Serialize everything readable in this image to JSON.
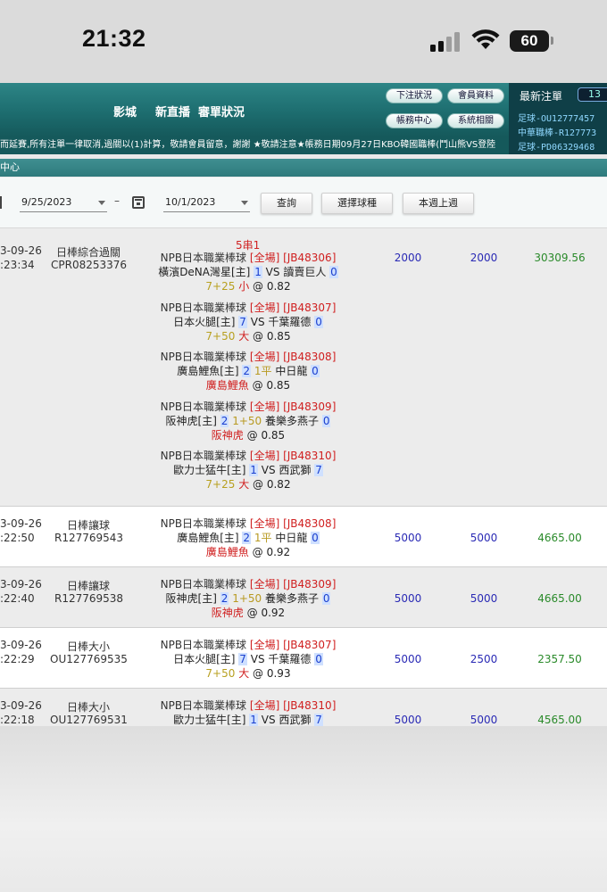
{
  "status_bar": {
    "time": "21:32",
    "battery": "60"
  },
  "nav": {
    "links": [
      "影城",
      "新直播",
      "審單狀況"
    ],
    "buttons": [
      "下注狀況",
      "會員資料",
      "帳務中心",
      "系統相關"
    ],
    "latest_title": "最新注單",
    "latest_count": "13",
    "latest_items": [
      "足球-OU12777457",
      "中華職棒-R127773",
      "足球-PD06329468"
    ]
  },
  "ticker": "而延賽,所有注單一律取消,過關以(1)計算，敬請會員留意，謝謝 ★敬請注意★帳務日期09月27日KBO韓國職棒(鬥山熊VS登陸",
  "section_title": "中心",
  "filter": {
    "start_date": "9/25/2023",
    "end_date": "10/1/2023",
    "dash": "–",
    "buttons": [
      "查詢",
      "選擇球種",
      "本週上週"
    ]
  },
  "rows": [
    {
      "date": "3-09-26",
      "time": ":23:34",
      "type": "日棒綜合過關",
      "id": "CPR08253376",
      "combo": "5串1",
      "stake": "2000",
      "valid": "2000",
      "result": "30309.56",
      "bets": [
        {
          "league": "NPB日本職業棒球",
          "market": "[全場] [JB48306]",
          "home": "橫濱DeNA灣星[主]",
          "hs": "1",
          "mid": "VS",
          "away": "讀賣巨人",
          "as": "0",
          "handicap": "7+25",
          "pick": "小",
          "odds": "@ 0.82"
        },
        {
          "league": "NPB日本職業棒球",
          "market": "[全場] [JB48307]",
          "home": "日本火腿[主]",
          "hs": "7",
          "mid": "VS",
          "away": "千葉羅德",
          "as": "0",
          "handicap": "7+50",
          "pick": "大",
          "odds": "@ 0.85"
        },
        {
          "league": "NPB日本職業棒球",
          "market": "[全場] [JB48308]",
          "home": "廣島鯉魚[主]",
          "hs": "2",
          "mid": "1平",
          "away": "中日龍",
          "as": "0",
          "handicap": "",
          "pick": "廣島鯉魚",
          "odds": "@ 0.85"
        },
        {
          "league": "NPB日本職業棒球",
          "market": "[全場] [JB48309]",
          "home": "阪神虎[主]",
          "hs": "2",
          "mid": "1+50",
          "away": "養樂多燕子",
          "as": "0",
          "handicap": "",
          "pick": "阪神虎",
          "odds": "@ 0.85"
        },
        {
          "league": "NPB日本職業棒球",
          "market": "[全場] [JB48310]",
          "home": "歐力士猛牛[主]",
          "hs": "1",
          "mid": "VS",
          "away": "西武獅",
          "as": "7",
          "handicap": "7+25",
          "pick": "大",
          "odds": "@ 0.82"
        }
      ]
    },
    {
      "date": "3-09-26",
      "time": ":22:50",
      "type": "日棒讓球",
      "id": "R127769543",
      "stake": "5000",
      "valid": "5000",
      "result": "4665.00",
      "bets": [
        {
          "league": "NPB日本職業棒球",
          "market": "[全場] [JB48308]",
          "home": "廣島鯉魚[主]",
          "hs": "2",
          "mid": "1平",
          "away": "中日龍",
          "as": "0",
          "handicap": "",
          "pick": "廣島鯉魚",
          "odds": "@ 0.92"
        }
      ]
    },
    {
      "date": "3-09-26",
      "time": ":22:40",
      "type": "日棒讓球",
      "id": "R127769538",
      "stake": "5000",
      "valid": "5000",
      "result": "4665.00",
      "bets": [
        {
          "league": "NPB日本職業棒球",
          "market": "[全場] [JB48309]",
          "home": "阪神虎[主]",
          "hs": "2",
          "mid": "1+50",
          "away": "養樂多燕子",
          "as": "0",
          "handicap": "",
          "pick": "阪神虎",
          "odds": "@ 0.92"
        }
      ]
    },
    {
      "date": "3-09-26",
      "time": ":22:29",
      "type": "日棒大小",
      "id": "OU127769535",
      "stake": "5000",
      "valid": "2500",
      "result": "2357.50",
      "bets": [
        {
          "league": "NPB日本職業棒球",
          "market": "[全場] [JB48307]",
          "home": "日本火腿[主]",
          "hs": "7",
          "mid": "VS",
          "away": "千葉羅德",
          "as": "0",
          "handicap": "7+50",
          "pick": "大",
          "odds": "@ 0.93"
        }
      ]
    },
    {
      "date": "3-09-26",
      "time": ":22:18",
      "type": "日棒大小",
      "id": "OU127769531",
      "stake": "5000",
      "valid": "5000",
      "result": "4565.00",
      "bets": [
        {
          "league": "NPB日本職業棒球",
          "market": "[全場] [JB48310]",
          "home": "歐力士猛牛[主]",
          "hs": "1",
          "mid": "VS",
          "away": "西武獅",
          "as": "7",
          "handicap": "",
          "pick": "",
          "odds": ""
        }
      ]
    }
  ]
}
